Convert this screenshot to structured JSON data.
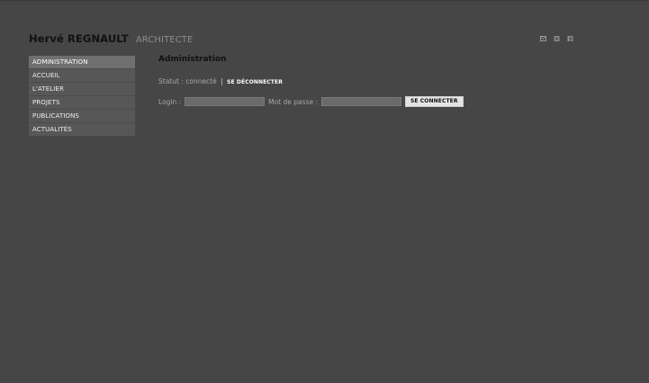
{
  "brand": {
    "name": "Hervé REGNAULT",
    "subtitle": "ARCHITECTE"
  },
  "top_icons": [
    "mail-icon",
    "rss-icon",
    "facebook-icon"
  ],
  "sidebar": {
    "items": [
      {
        "label": "ADMINISTRATION",
        "active": true
      },
      {
        "label": "ACCUEIL",
        "active": false
      },
      {
        "label": "L'ATELIER",
        "active": false
      },
      {
        "label": "PROJETS",
        "active": false
      },
      {
        "label": "PUBLICATIONS",
        "active": false
      },
      {
        "label": "ACTUALITÉS",
        "active": false
      }
    ]
  },
  "main": {
    "title": "Administration",
    "status_text": "Statut : connecté",
    "status_separator": "|",
    "logout_label": "SE DÉCONNECTER",
    "login_label": "Login :",
    "login_value": "",
    "password_label": "Mot de passe :",
    "password_value": "",
    "submit_label": "SE CONNECTER"
  },
  "colors": {
    "background": "#464646",
    "sidebar_item": "#575757",
    "sidebar_active": "#6f6f6f",
    "input_bg": "#6a6a6a",
    "button_bg": "#e4e4e4"
  }
}
